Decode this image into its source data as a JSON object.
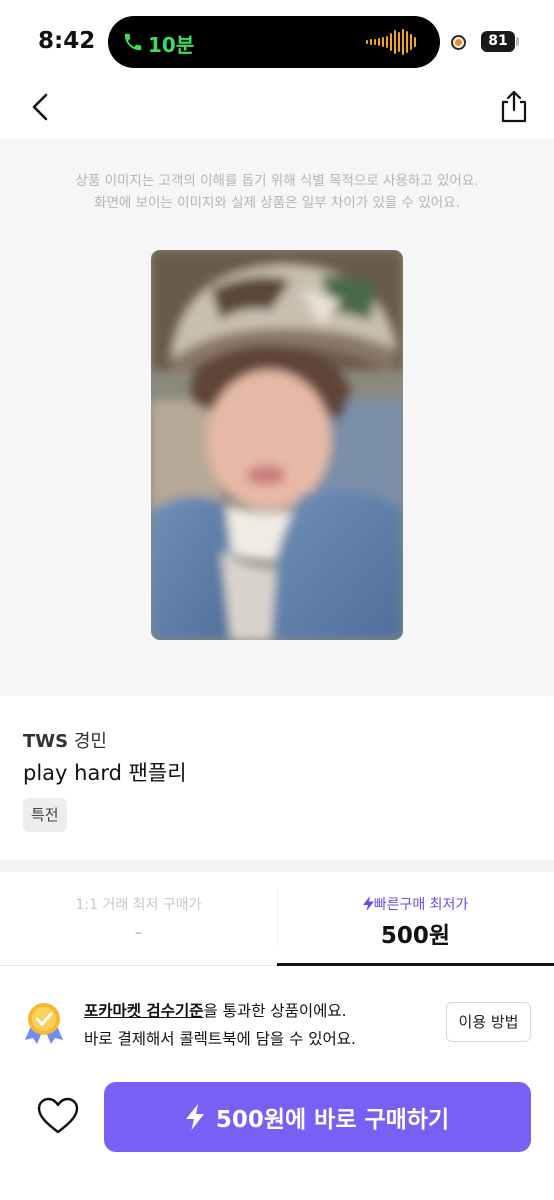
{
  "status_bar": {
    "time": "8:42",
    "call_duration": "10분",
    "battery": "81"
  },
  "notice": {
    "line1": "상품 이미지는 고객의 이해를 돕기 위해 식별 목적으로 사용하고 있어요.",
    "line2": "화면에 보이는 이미지와 실제 상품은 일부 차이가 있을 수 있어요."
  },
  "product": {
    "artist": "TWS",
    "member": "경민",
    "title": "play hard 팬플리",
    "tag": "특전"
  },
  "price_tabs": {
    "left_label": "1:1 거래 최저 구매가",
    "left_value": "-",
    "right_label": "빠른구매 최저가",
    "right_value": "500원"
  },
  "inspection": {
    "link_text": "포카마켓 검수기준",
    "line1_suffix": "을 통과한 상품이에요.",
    "line2": "바로 결제해서 콜렉트북에 담을 수 있어요.",
    "howto_label": "이용 방법"
  },
  "bottom": {
    "buy_label": "500원에 바로 구매하기"
  },
  "colors": {
    "accent": "#7760f3",
    "accent_text": "#6b4dea",
    "call_green": "#3ddc5c"
  },
  "icons": [
    "phone-icon",
    "audio-wave-icon",
    "back-chevron-icon",
    "share-icon",
    "verified-badge-icon",
    "heart-icon",
    "lightning-icon"
  ]
}
